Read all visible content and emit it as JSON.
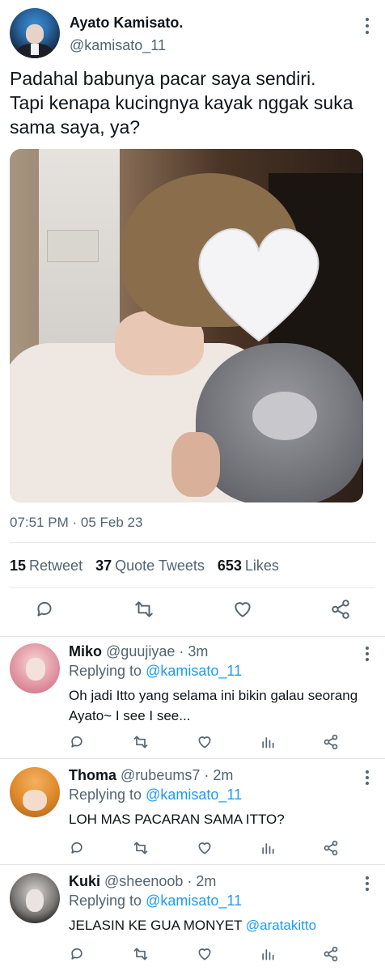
{
  "tweet": {
    "author_name": "Ayato Kamisato.",
    "author_handle": "@kamisato_11",
    "text": "Padahal babunya pacar saya sendiri.\nTapi kenapa kucingnya kayak nggak suka sama saya, ya?",
    "timestamp": "07:51 PM · 05 Feb 23",
    "stats": {
      "retweets_count": "15",
      "retweets_label": "Retweet",
      "quotes_count": "37",
      "quotes_label": "Quote Tweets",
      "likes_count": "653",
      "likes_label": "Likes"
    }
  },
  "replies": [
    {
      "name": "Miko",
      "handle": "@guujiyae",
      "time": "· 3m",
      "replying_prefix": "Replying to",
      "replying_to": "@kamisato_11",
      "text": "Oh jadi Itto yang selama ini bikin galau seorang Ayato~ I see I see..."
    },
    {
      "name": "Thoma",
      "handle": "@rubeums7",
      "time": "· 2m",
      "replying_prefix": "Replying to",
      "replying_to": "@kamisato_11",
      "text": "LOH MAS PACARAN SAMA ITTO?"
    },
    {
      "name": "Kuki",
      "handle": "@sheenoob",
      "time": "· 2m",
      "replying_prefix": "Replying to",
      "replying_to": "@kamisato_11",
      "text": "JELASIN KE GUA MONYET",
      "text_mention": "@aratakitto"
    }
  ],
  "icons": {
    "reply": "reply-icon",
    "retweet": "retweet-icon",
    "like": "heart-icon",
    "share": "share-icon",
    "analytics": "analytics-icon",
    "more": "more-options-icon"
  },
  "colors": {
    "text": "#0f1419",
    "secondary": "#536471",
    "link": "#1d9bf0"
  }
}
